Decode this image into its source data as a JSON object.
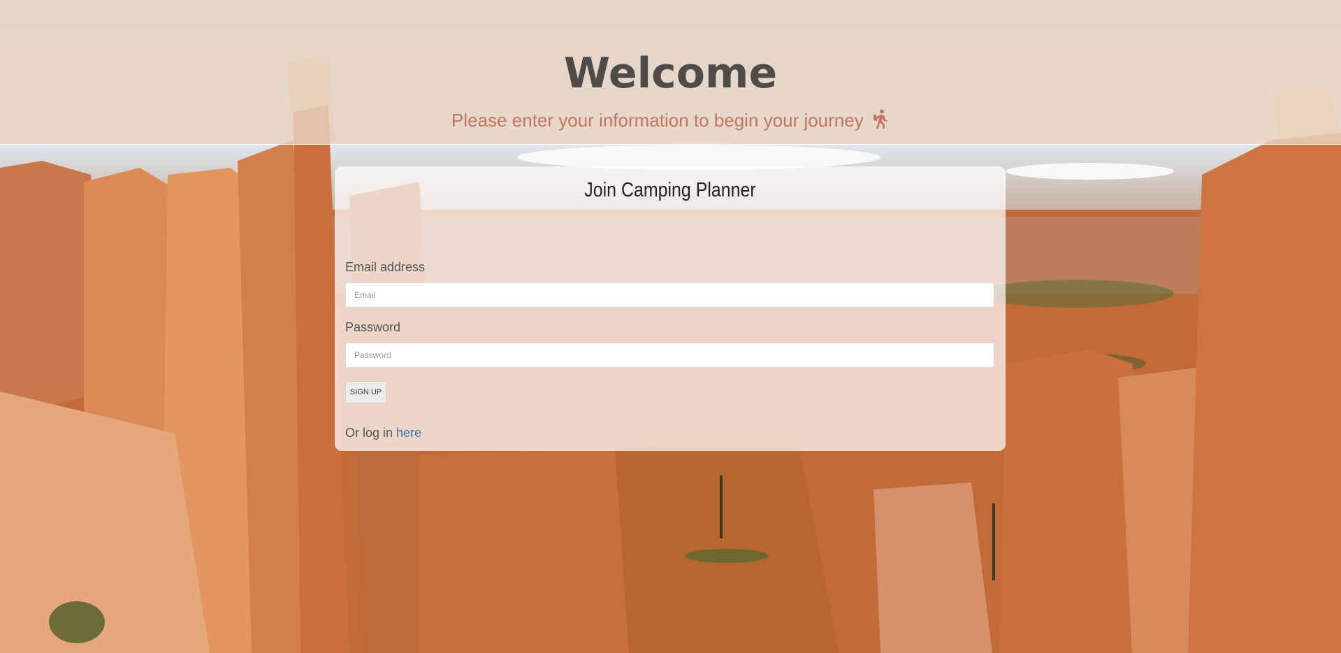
{
  "hero": {
    "title": "Welcome",
    "subtitle": "Please enter your information to begin your journey",
    "subtitle_icon": "hiking-icon"
  },
  "card": {
    "title": "Join Camping Planner",
    "email": {
      "label": "Email address",
      "placeholder": "Email",
      "value": ""
    },
    "password": {
      "label": "Password",
      "placeholder": "Password",
      "value": ""
    },
    "submit_label": "SIGN UP",
    "login_prefix": "Or log in",
    "login_link": "here"
  },
  "colors": {
    "accent": "#c27661",
    "link": "#337ab7",
    "title": "#4f4b49"
  }
}
